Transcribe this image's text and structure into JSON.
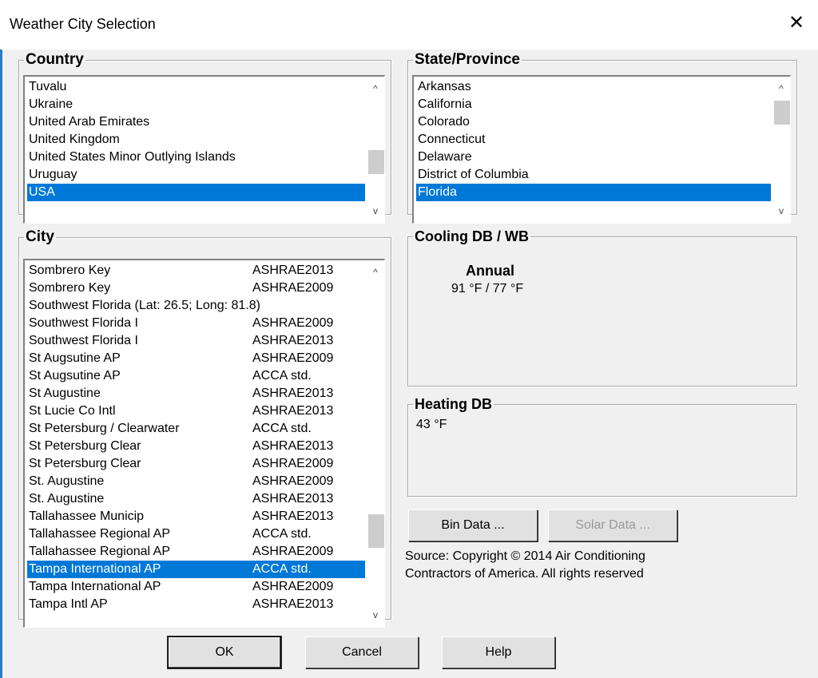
{
  "window": {
    "title": "Weather City Selection",
    "close_glyph": "✕"
  },
  "country": {
    "legend": "Country",
    "items": [
      "Tuvalu",
      "Ukraine",
      "United Arab Emirates",
      "United Kingdom",
      "United States Minor Outlying Islands",
      "Uruguay",
      "USA"
    ],
    "selected_index": 6
  },
  "state": {
    "legend": "State/Province",
    "items": [
      "Arkansas",
      "California",
      "Colorado",
      "Connecticut",
      "Delaware",
      "District of Columbia",
      "Florida"
    ],
    "selected_index": 6
  },
  "city": {
    "legend": "City",
    "rows": [
      {
        "name": "Sombrero Key",
        "source": "ASHRAE2013"
      },
      {
        "name": "Sombrero Key",
        "source": "ASHRAE2009"
      },
      {
        "name": "Southwest Florida (Lat: 26.5; Long: 81.8)",
        "source": ""
      },
      {
        "name": "Southwest Florida I",
        "source": "ASHRAE2009"
      },
      {
        "name": "Southwest Florida I",
        "source": "ASHRAE2013"
      },
      {
        "name": "St Augsutine AP",
        "source": "ASHRAE2009"
      },
      {
        "name": "St Augsutine AP",
        "source": "ACCA std."
      },
      {
        "name": "St Augustine",
        "source": "ASHRAE2013"
      },
      {
        "name": "St Lucie Co Intl",
        "source": "ASHRAE2013"
      },
      {
        "name": "St Petersburg / Clearwater",
        "source": "ACCA std."
      },
      {
        "name": "St Petersburg Clear",
        "source": "ASHRAE2013"
      },
      {
        "name": "St Petersburg Clear",
        "source": "ASHRAE2009"
      },
      {
        "name": "St. Augustine",
        "source": "ASHRAE2009"
      },
      {
        "name": "St. Augustine",
        "source": "ASHRAE2013"
      },
      {
        "name": "Tallahassee Municip",
        "source": "ASHRAE2013"
      },
      {
        "name": "Tallahassee Regional AP",
        "source": "ACCA std."
      },
      {
        "name": "Tallahassee Regional AP",
        "source": "ASHRAE2009"
      },
      {
        "name": "Tampa International AP",
        "source": "ACCA std."
      },
      {
        "name": "Tampa International AP",
        "source": "ASHRAE2009"
      },
      {
        "name": "Tampa Intl AP",
        "source": "ASHRAE2013"
      }
    ],
    "selected_index": 17
  },
  "cooling": {
    "legend": "Cooling DB / WB",
    "heading": "Annual",
    "value": "91 °F / 77 °F"
  },
  "heating": {
    "legend": "Heating DB",
    "value": "43 °F"
  },
  "buttons": {
    "bin_data": "Bin Data ...",
    "solar_data": "Solar Data ...",
    "ok": "OK",
    "cancel": "Cancel",
    "help": "Help"
  },
  "source_text": "Source: Copyright © 2014 Air Conditioning Contractors of America. All rights reserved",
  "scroll_glyphs": {
    "up": "^",
    "down": "v"
  },
  "colors": {
    "selection": "#0078d7",
    "dialog_bg": "#f0f0f0"
  }
}
